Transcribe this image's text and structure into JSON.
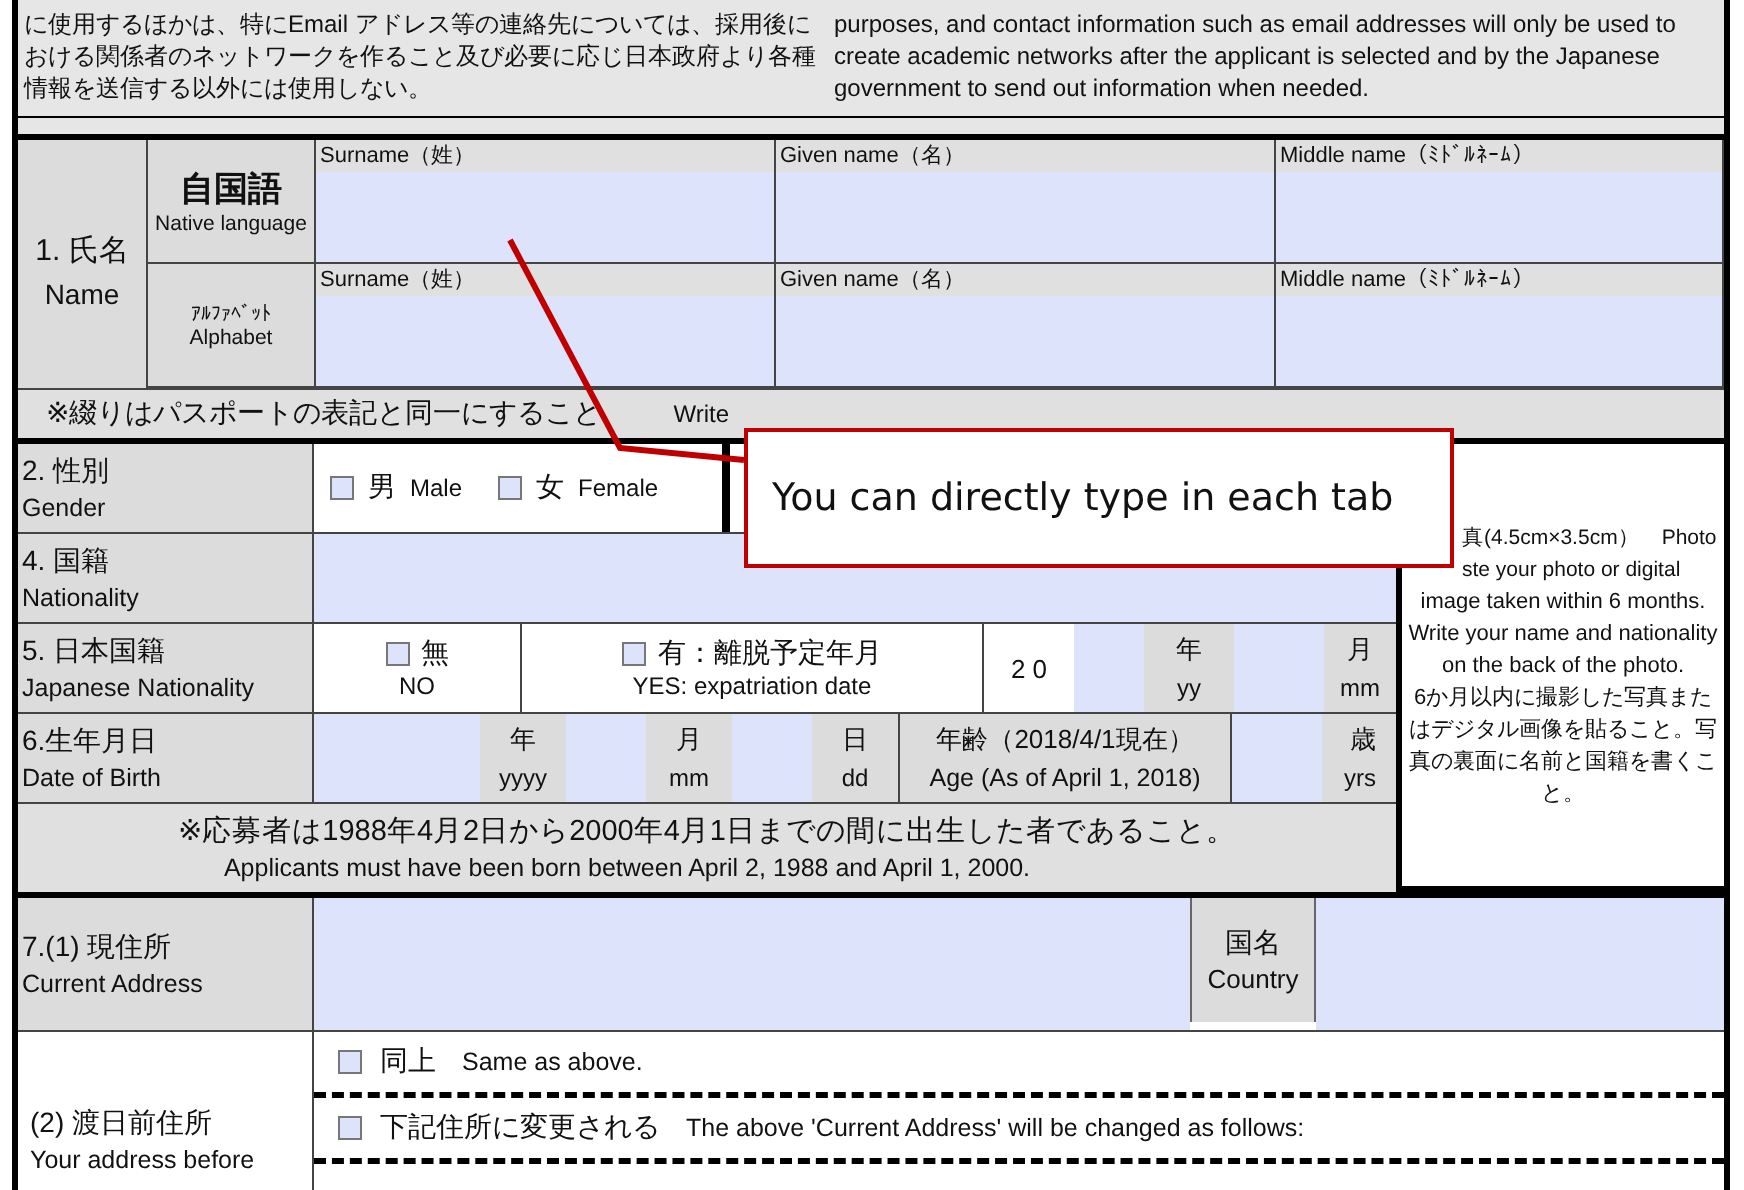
{
  "notice": {
    "japanese": "に使用するほかは、特にEmail アドレス等の連絡先については、採用後における関係者のネットワークを作ること及び必要に応じ日本政府より各種情報を送信する以外には使用しない。",
    "english": "purposes, and contact information such as email addresses will only be used to create academic networks after the applicant is selected and by the Japanese government to send out information when needed."
  },
  "name_section": {
    "label_ja": "1. 氏名",
    "label_en": "Name",
    "rows": [
      {
        "label_ja": "自国語",
        "label_en": "Native language",
        "columns": [
          "Surname（姓）",
          "Given name（名）",
          "Middle name（ﾐﾄﾞﾙﾈｰﾑ）"
        ]
      },
      {
        "label_ja": "ｱﾙﾌｧﾍﾞｯﾄ",
        "label_en": "Alphabet",
        "columns": [
          "Surname（姓）",
          "Given name（名）",
          "Middle name（ﾐﾄﾞﾙﾈｰﾑ）"
        ]
      }
    ],
    "note_ja": "※綴りはパスポートの表記と同一にすること",
    "note_en": "Write"
  },
  "gender": {
    "label_ja": "2. 性別",
    "label_en": "Gender",
    "options": [
      {
        "label_ja": "男",
        "label_en": "Male",
        "checked": false
      },
      {
        "label_ja": "女",
        "label_en": "Female",
        "checked": false
      }
    ]
  },
  "nationality": {
    "label_ja": "4. 国籍",
    "label_en": "Nationality"
  },
  "japanese_nationality": {
    "label_ja": "5. 日本国籍",
    "label_en": "Japanese Nationality",
    "options": [
      {
        "label_ja": "無",
        "label_en": "NO",
        "checked": false
      },
      {
        "label_ja": "有：離脱予定年月",
        "label_en": "YES: expatriation date",
        "checked": false
      }
    ],
    "year_prefix": "2 0",
    "year_ja": "年",
    "year_en": "yy",
    "month_ja": "月",
    "month_en": "mm"
  },
  "date_of_birth": {
    "label_ja": "6.生年月日",
    "label_en": "Date of Birth",
    "parts": [
      {
        "ja": "年",
        "en": "yyyy"
      },
      {
        "ja": "月",
        "en": "mm"
      },
      {
        "ja": "日",
        "en": "dd"
      }
    ],
    "age_ja": "年齢（2018/4/1現在）",
    "age_en": "Age (As of April 1, 2018)",
    "age_unit_ja": "歳",
    "age_unit_en": "yrs"
  },
  "eligibility_note": {
    "japanese": "※応募者は1988年4月2日から2000年4月1日までの間に出生した者であること。",
    "english": "Applicants must have been born between April 2, 1988 and April 1, 2000."
  },
  "photo": {
    "lines": [
      "真(4.5cm×3.5cm）　Photo",
      "ste your photo or digital",
      "image taken within 6 months. Write your name and nationality on the back of the photo.",
      "6か月以内に撮影した写真またはデジタル画像を貼ること。写真の裏面に名前と国籍を書くこと。"
    ]
  },
  "current_address": {
    "label_ja": "7.(1) 現住所",
    "label_en": "Current Address",
    "country_ja": "国名",
    "country_en": "Country"
  },
  "previous_address": {
    "label_ja": "(2) 渡日前住所",
    "label_en": "Your address before",
    "options": [
      {
        "label_ja": "同上",
        "label_en": "Same as above.",
        "checked": false
      },
      {
        "label_ja": "下記住所に変更される",
        "label_en": "The above 'Current Address' will be changed as follows:",
        "checked": false
      }
    ]
  },
  "callout": {
    "text": "You can directly type in each tab"
  }
}
